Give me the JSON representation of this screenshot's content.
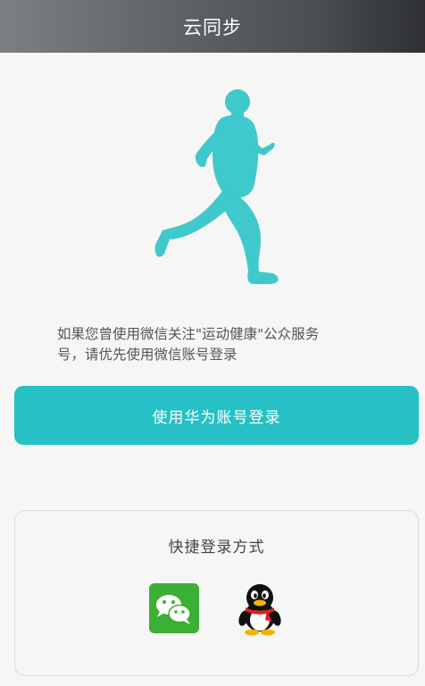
{
  "header": {
    "title": "云同步"
  },
  "info": {
    "line1": "如果您曾使用微信关注\"运动健康\"公众服务",
    "line2": "号，请优先使用微信账号登录"
  },
  "primary": {
    "huawei_login_label": "使用华为账号登录"
  },
  "quick_login": {
    "title": "快捷登录方式",
    "options": [
      "wechat-icon",
      "qq-icon"
    ]
  },
  "colors": {
    "accent": "#27c0c5",
    "runner": "#3fc9cc",
    "wechat": "#3cb034"
  }
}
